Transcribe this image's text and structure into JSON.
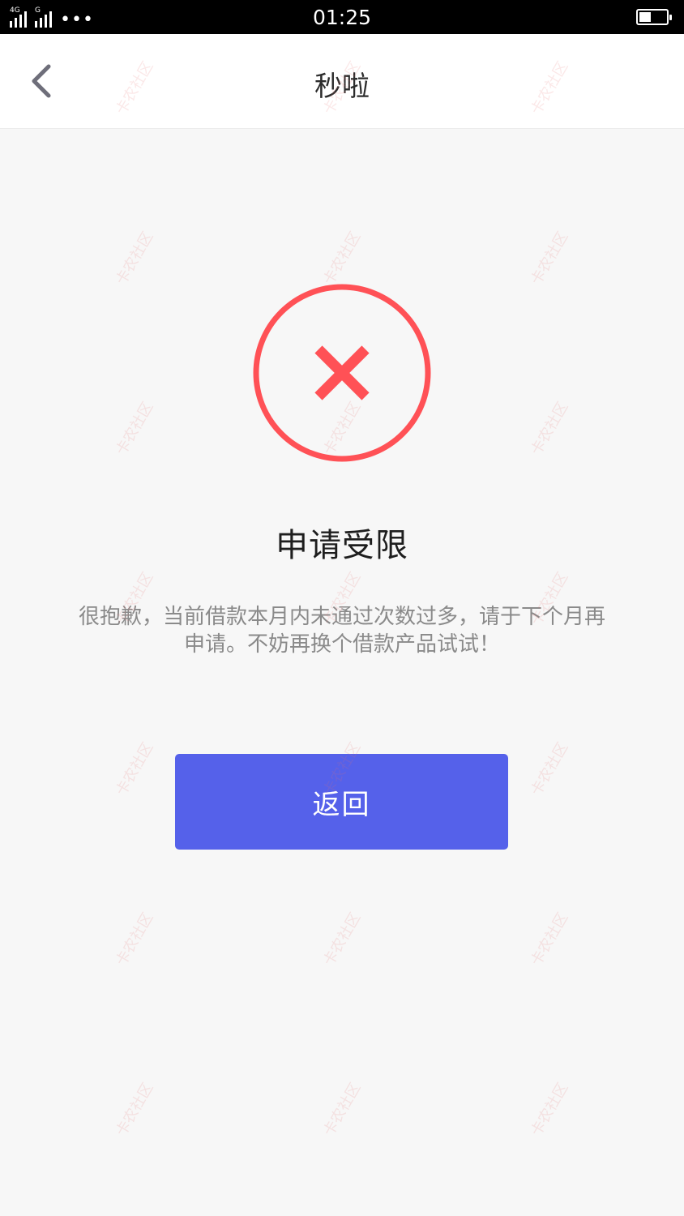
{
  "status_bar": {
    "signal_1_tag": "4G",
    "signal_2_tag": "G",
    "more": "•••",
    "time": "01:25"
  },
  "header": {
    "title": "秒啦",
    "back_icon": "chevron-left-icon"
  },
  "result": {
    "icon": "error-x-icon",
    "icon_color": "#ff5156",
    "title": "申请受限",
    "message": "很抱歉，当前借款本月内未通过次数过多，请于下个月再申请。不妨再换个借款产品试试！"
  },
  "actions": {
    "return_label": "返回",
    "button_color": "#5561ea"
  },
  "watermark": {
    "text": "卡农社区"
  }
}
